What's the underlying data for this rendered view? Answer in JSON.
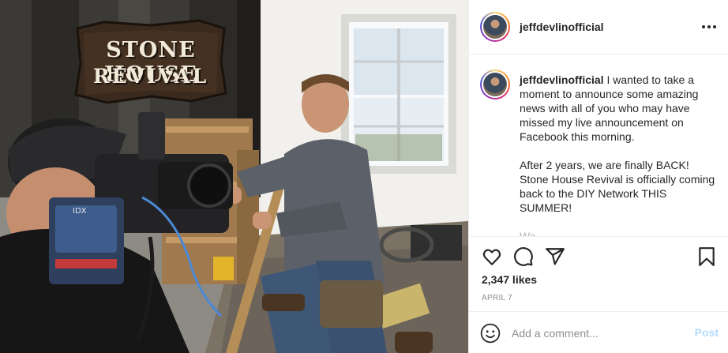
{
  "post": {
    "image_logo": {
      "line1": "STONE HOUSE",
      "line2": "REVIVAL"
    },
    "header": {
      "username": "jeffdevlinofficial",
      "more_icon": "more-horizontal-icon"
    },
    "caption": {
      "username": "jeffdevlinofficial",
      "paragraph1": "I wanted to take a moment to announce some amazing news with all of you who may have missed my live announcement on Facebook this morning.",
      "paragraph2": "After 2 years, we are finally BACK! Stone House Revival is officially coming back to the DIY Network THIS SUMMER!",
      "paragraph3_partial": "We ... ... ... ..."
    },
    "actions": {
      "icons": [
        "heart-icon",
        "comment-icon",
        "share-icon",
        "bookmark-icon"
      ]
    },
    "likes": "2,347 likes",
    "date": "APRIL 7",
    "comment_box": {
      "placeholder": "Add a comment...",
      "post_label": "Post",
      "emoji_icon": "emoji-icon"
    },
    "colors": {
      "accent_post_disabled": "#b3dbff",
      "text": "#262626",
      "muted": "#8e8e8e",
      "divider": "#efefef"
    }
  }
}
